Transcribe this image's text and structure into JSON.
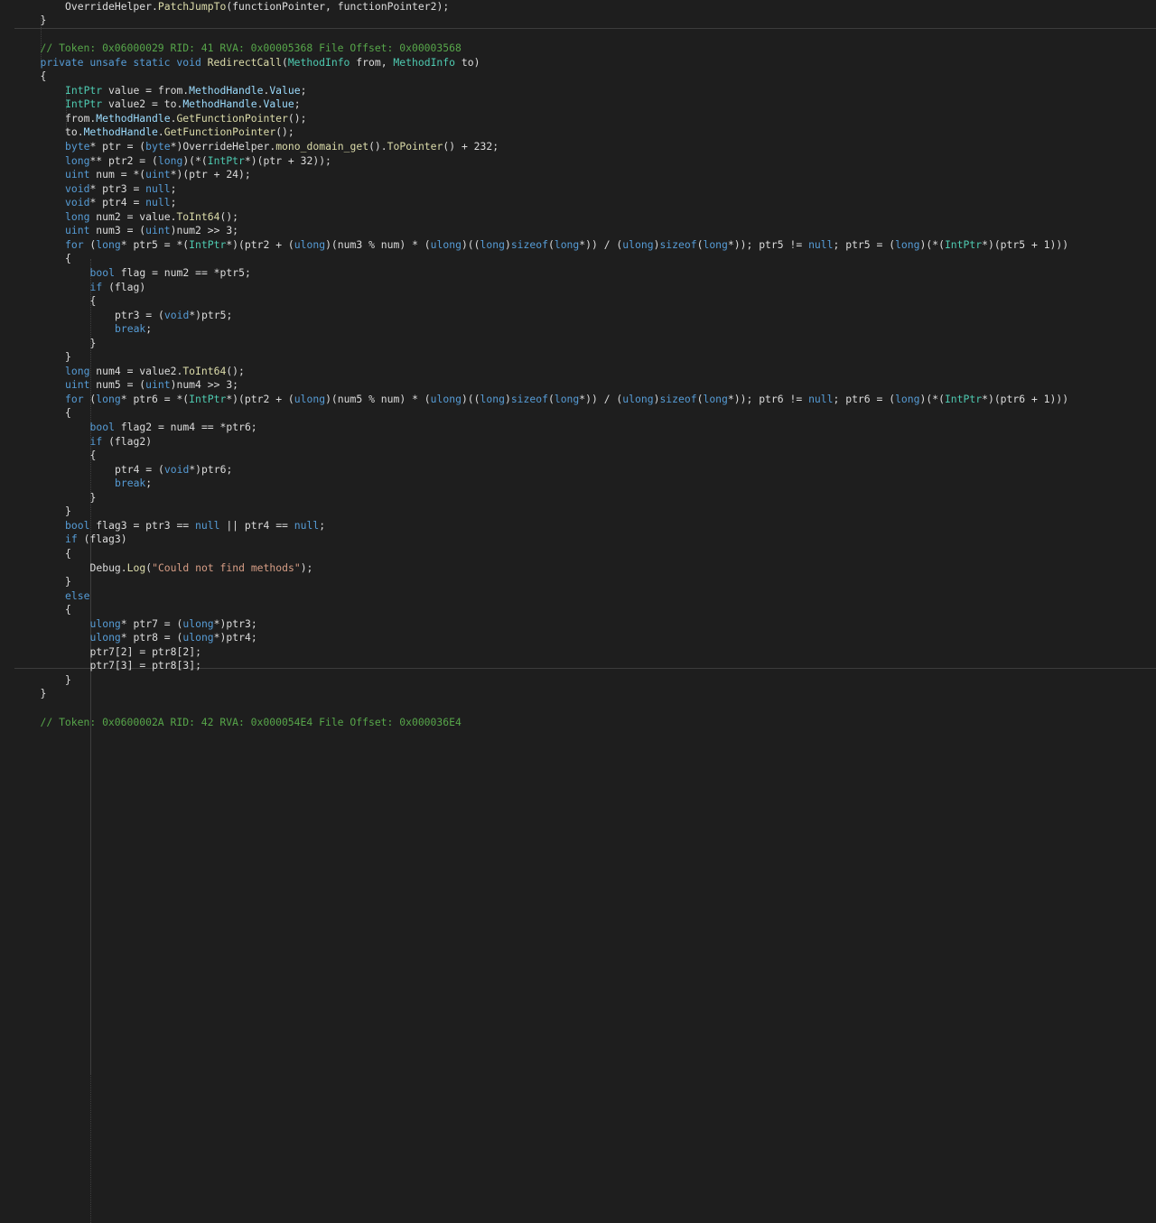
{
  "colors": {
    "background": "#1e1e1e",
    "text": "#dcdcdc",
    "keyword": "#569cd6",
    "type": "#4ec9b0",
    "method": "#dcdcaa",
    "property": "#9cdcfe",
    "comment": "#57a64a",
    "string": "#d69d85",
    "number": "#b5cea8"
  },
  "lines": [
    [
      [
        "",
        "\t\tOverrideHelper."
      ],
      [
        "m",
        "PatchJumpTo"
      ],
      [
        "",
        "(functionPointer, functionPointer2);"
      ]
    ],
    [
      [
        "",
        "\t}"
      ]
    ],
    [
      [
        "",
        ""
      ]
    ],
    [
      [
        "c",
        "\t// Token: 0x06000029 RID: 41 RVA: 0x00005368 File Offset: 0x00003568"
      ]
    ],
    [
      [
        "k",
        "\tprivate unsafe static void "
      ],
      [
        "m",
        "RedirectCall"
      ],
      [
        "",
        "("
      ],
      [
        "t",
        "MethodInfo"
      ],
      [
        "",
        " from, "
      ],
      [
        "t",
        "MethodInfo"
      ],
      [
        "",
        " to)"
      ]
    ],
    [
      [
        "",
        "\t{"
      ]
    ],
    [
      [
        "",
        "\t\t"
      ],
      [
        "t",
        "IntPtr"
      ],
      [
        "",
        " value = from."
      ],
      [
        "p",
        "MethodHandle"
      ],
      [
        "",
        "."
      ],
      [
        "p",
        "Value"
      ],
      [
        "",
        ";"
      ]
    ],
    [
      [
        "",
        "\t\t"
      ],
      [
        "t",
        "IntPtr"
      ],
      [
        "",
        " value2 = to."
      ],
      [
        "p",
        "MethodHandle"
      ],
      [
        "",
        "."
      ],
      [
        "p",
        "Value"
      ],
      [
        "",
        ";"
      ]
    ],
    [
      [
        "",
        "\t\tfrom."
      ],
      [
        "p",
        "MethodHandle"
      ],
      [
        "",
        "."
      ],
      [
        "m",
        "GetFunctionPointer"
      ],
      [
        "",
        "();"
      ]
    ],
    [
      [
        "",
        "\t\tto."
      ],
      [
        "p",
        "MethodHandle"
      ],
      [
        "",
        "."
      ],
      [
        "m",
        "GetFunctionPointer"
      ],
      [
        "",
        "();"
      ]
    ],
    [
      [
        "",
        "\t\t"
      ],
      [
        "k",
        "byte"
      ],
      [
        "",
        "* ptr = ("
      ],
      [
        "k",
        "byte"
      ],
      [
        "",
        "*)OverrideHelper."
      ],
      [
        "m",
        "mono_domain_get"
      ],
      [
        "",
        "()."
      ],
      [
        "m",
        "ToPointer"
      ],
      [
        "",
        "() + 232;"
      ]
    ],
    [
      [
        "",
        "\t\t"
      ],
      [
        "k",
        "long"
      ],
      [
        "",
        "** ptr2 = ("
      ],
      [
        "k",
        "long"
      ],
      [
        "",
        ")(*("
      ],
      [
        "t",
        "IntPtr"
      ],
      [
        "",
        "*)(ptr + 32));"
      ]
    ],
    [
      [
        "",
        "\t\t"
      ],
      [
        "k",
        "uint"
      ],
      [
        "",
        " num = *("
      ],
      [
        "k",
        "uint"
      ],
      [
        "",
        "*)(ptr + 24);"
      ]
    ],
    [
      [
        "",
        "\t\t"
      ],
      [
        "k",
        "void"
      ],
      [
        "",
        "* ptr3 = "
      ],
      [
        "k",
        "null"
      ],
      [
        "",
        ";"
      ]
    ],
    [
      [
        "",
        "\t\t"
      ],
      [
        "k",
        "void"
      ],
      [
        "",
        "* ptr4 = "
      ],
      [
        "k",
        "null"
      ],
      [
        "",
        ";"
      ]
    ],
    [
      [
        "",
        "\t\t"
      ],
      [
        "k",
        "long"
      ],
      [
        "",
        " num2 = value."
      ],
      [
        "m",
        "ToInt64"
      ],
      [
        "",
        "();"
      ]
    ],
    [
      [
        "",
        "\t\t"
      ],
      [
        "k",
        "uint"
      ],
      [
        "",
        " num3 = ("
      ],
      [
        "k",
        "uint"
      ],
      [
        "",
        ")num2 >> 3;"
      ]
    ],
    [
      [
        "",
        "\t\t"
      ],
      [
        "k",
        "for"
      ],
      [
        "",
        " ("
      ],
      [
        "k",
        "long"
      ],
      [
        "",
        "* ptr5 = *("
      ],
      [
        "t",
        "IntPtr"
      ],
      [
        "",
        "*)(ptr2 + ("
      ],
      [
        "k",
        "ulong"
      ],
      [
        "",
        ")(num3 % num) * ("
      ],
      [
        "k",
        "ulong"
      ],
      [
        "",
        ")(("
      ],
      [
        "k",
        "long"
      ],
      [
        "",
        ")"
      ],
      [
        "k",
        "sizeof"
      ],
      [
        "",
        "("
      ],
      [
        "k",
        "long"
      ],
      [
        "",
        "*)) / ("
      ],
      [
        "k",
        "ulong"
      ],
      [
        "",
        ")"
      ],
      [
        "k",
        "sizeof"
      ],
      [
        "",
        "("
      ],
      [
        "k",
        "long"
      ],
      [
        "",
        "*)); ptr5 != "
      ],
      [
        "k",
        "null"
      ],
      [
        "",
        "; ptr5 = ("
      ],
      [
        "k",
        "long"
      ],
      [
        "",
        ")(*("
      ],
      [
        "t",
        "IntPtr"
      ],
      [
        "",
        "*)(ptr5 + 1)))"
      ]
    ],
    [
      [
        "",
        "\t\t{"
      ]
    ],
    [
      [
        "",
        "\t\t\t"
      ],
      [
        "k",
        "bool"
      ],
      [
        "",
        " flag = num2 == *ptr5;"
      ]
    ],
    [
      [
        "",
        "\t\t\t"
      ],
      [
        "k",
        "if"
      ],
      [
        "",
        " (flag)"
      ]
    ],
    [
      [
        "",
        "\t\t\t{"
      ]
    ],
    [
      [
        "",
        "\t\t\t\tptr3 = ("
      ],
      [
        "k",
        "void"
      ],
      [
        "",
        "*)ptr5;"
      ]
    ],
    [
      [
        "",
        "\t\t\t\t"
      ],
      [
        "k",
        "break"
      ],
      [
        "",
        ";"
      ]
    ],
    [
      [
        "",
        "\t\t\t}"
      ]
    ],
    [
      [
        "",
        "\t\t}"
      ]
    ],
    [
      [
        "",
        "\t\t"
      ],
      [
        "k",
        "long"
      ],
      [
        "",
        " num4 = value2."
      ],
      [
        "m",
        "ToInt64"
      ],
      [
        "",
        "();"
      ]
    ],
    [
      [
        "",
        "\t\t"
      ],
      [
        "k",
        "uint"
      ],
      [
        "",
        " num5 = ("
      ],
      [
        "k",
        "uint"
      ],
      [
        "",
        ")num4 >> 3;"
      ]
    ],
    [
      [
        "",
        "\t\t"
      ],
      [
        "k",
        "for"
      ],
      [
        "",
        " ("
      ],
      [
        "k",
        "long"
      ],
      [
        "",
        "* ptr6 = *("
      ],
      [
        "t",
        "IntPtr"
      ],
      [
        "",
        "*)(ptr2 + ("
      ],
      [
        "k",
        "ulong"
      ],
      [
        "",
        ")(num5 % num) * ("
      ],
      [
        "k",
        "ulong"
      ],
      [
        "",
        ")(("
      ],
      [
        "k",
        "long"
      ],
      [
        "",
        ")"
      ],
      [
        "k",
        "sizeof"
      ],
      [
        "",
        "("
      ],
      [
        "k",
        "long"
      ],
      [
        "",
        "*)) / ("
      ],
      [
        "k",
        "ulong"
      ],
      [
        "",
        ")"
      ],
      [
        "k",
        "sizeof"
      ],
      [
        "",
        "("
      ],
      [
        "k",
        "long"
      ],
      [
        "",
        "*)); ptr6 != "
      ],
      [
        "k",
        "null"
      ],
      [
        "",
        "; ptr6 = ("
      ],
      [
        "k",
        "long"
      ],
      [
        "",
        ")(*("
      ],
      [
        "t",
        "IntPtr"
      ],
      [
        "",
        "*)(ptr6 + 1)))"
      ]
    ],
    [
      [
        "",
        "\t\t{"
      ]
    ],
    [
      [
        "",
        "\t\t\t"
      ],
      [
        "k",
        "bool"
      ],
      [
        "",
        " flag2 = num4 == *ptr6;"
      ]
    ],
    [
      [
        "",
        "\t\t\t"
      ],
      [
        "k",
        "if"
      ],
      [
        "",
        " (flag2)"
      ]
    ],
    [
      [
        "",
        "\t\t\t{"
      ]
    ],
    [
      [
        "",
        "\t\t\t\tptr4 = ("
      ],
      [
        "k",
        "void"
      ],
      [
        "",
        "*)ptr6;"
      ]
    ],
    [
      [
        "",
        "\t\t\t\t"
      ],
      [
        "k",
        "break"
      ],
      [
        "",
        ";"
      ]
    ],
    [
      [
        "",
        "\t\t\t}"
      ]
    ],
    [
      [
        "",
        "\t\t}"
      ]
    ],
    [
      [
        "",
        "\t\t"
      ],
      [
        "k",
        "bool"
      ],
      [
        "",
        " flag3 = ptr3 == "
      ],
      [
        "k",
        "null"
      ],
      [
        "",
        " || ptr4 == "
      ],
      [
        "k",
        "null"
      ],
      [
        "",
        ";"
      ]
    ],
    [
      [
        "",
        "\t\t"
      ],
      [
        "k",
        "if"
      ],
      [
        "",
        " (flag3)"
      ]
    ],
    [
      [
        "",
        "\t\t{"
      ]
    ],
    [
      [
        "",
        "\t\t\tDebug."
      ],
      [
        "m",
        "Log"
      ],
      [
        "",
        "("
      ],
      [
        "s",
        "\"Could not find methods\""
      ],
      [
        "",
        ");"
      ]
    ],
    [
      [
        "",
        "\t\t}"
      ]
    ],
    [
      [
        "",
        "\t\t"
      ],
      [
        "k",
        "else"
      ]
    ],
    [
      [
        "",
        "\t\t{"
      ]
    ],
    [
      [
        "",
        "\t\t\t"
      ],
      [
        "k",
        "ulong"
      ],
      [
        "",
        "* ptr7 = ("
      ],
      [
        "k",
        "ulong"
      ],
      [
        "",
        "*)ptr3;"
      ]
    ],
    [
      [
        "",
        "\t\t\t"
      ],
      [
        "k",
        "ulong"
      ],
      [
        "",
        "* ptr8 = ("
      ],
      [
        "k",
        "ulong"
      ],
      [
        "",
        "*)ptr4;"
      ]
    ],
    [
      [
        "",
        "\t\t\tptr7[2] = ptr8[2];"
      ]
    ],
    [
      [
        "",
        "\t\t\tptr7[3] = ptr8[3];"
      ]
    ],
    [
      [
        "",
        "\t\t}"
      ]
    ],
    [
      [
        "",
        "\t}"
      ]
    ],
    [
      [
        "",
        ""
      ]
    ],
    [
      [
        "c",
        "\t// Token: 0x0600002A RID: 42 RVA: 0x000054E4 File Offset: 0x000036E4"
      ]
    ]
  ]
}
